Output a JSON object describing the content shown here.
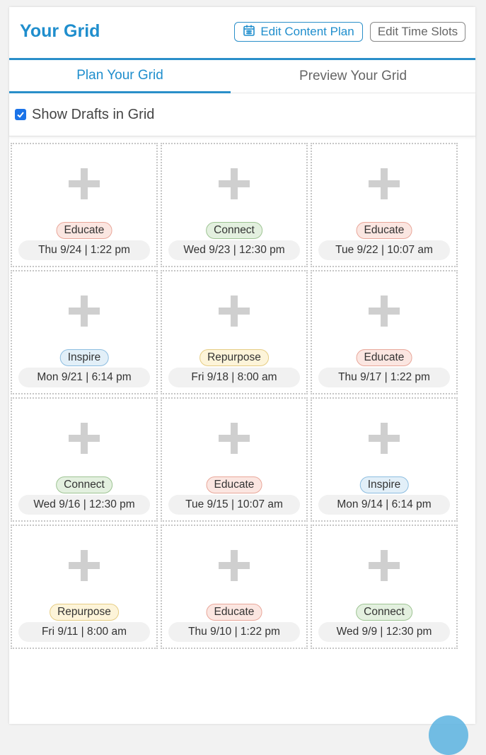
{
  "header": {
    "title": "Your Grid",
    "edit_content_plan_label": "Edit Content Plan",
    "edit_time_slots_label": "Edit Time Slots",
    "calendar_icon": "calendar-icon"
  },
  "tabs": [
    {
      "label": "Plan Your Grid",
      "active": true
    },
    {
      "label": "Preview Your Grid",
      "active": false
    }
  ],
  "drafts": {
    "label": "Show Drafts in Grid",
    "checked": true
  },
  "colors": {
    "accent": "#1f8ecd",
    "Educate": "#fbe6e1",
    "Connect": "#e3f0df",
    "Inspire": "#e2eff8",
    "Repurpose": "#fdf4d9"
  },
  "grid": {
    "slots": [
      {
        "tag": "Educate",
        "time": "Thu 9/24 | 1:22 pm"
      },
      {
        "tag": "Connect",
        "time": "Wed 9/23 | 12:30 pm"
      },
      {
        "tag": "Educate",
        "time": "Tue 9/22 | 10:07 am"
      },
      {
        "tag": "Inspire",
        "time": "Mon 9/21 | 6:14 pm"
      },
      {
        "tag": "Repurpose",
        "time": "Fri 9/18 | 8:00 am"
      },
      {
        "tag": "Educate",
        "time": "Thu 9/17 | 1:22 pm"
      },
      {
        "tag": "Connect",
        "time": "Wed 9/16 | 12:30 pm"
      },
      {
        "tag": "Educate",
        "time": "Tue 9/15 | 10:07 am"
      },
      {
        "tag": "Inspire",
        "time": "Mon 9/14 | 6:14 pm"
      },
      {
        "tag": "Repurpose",
        "time": "Fri 9/11 | 8:00 am"
      },
      {
        "tag": "Educate",
        "time": "Thu 9/10 | 1:22 pm"
      },
      {
        "tag": "Connect",
        "time": "Wed 9/9 | 12:30 pm"
      }
    ]
  }
}
